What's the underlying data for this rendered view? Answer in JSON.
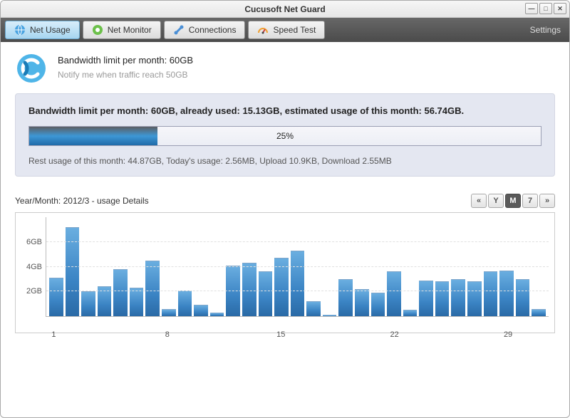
{
  "window": {
    "title": "Cucusoft Net Guard"
  },
  "tabs": [
    {
      "label": "Net Usage"
    },
    {
      "label": "Net Monitor"
    },
    {
      "label": "Connections"
    },
    {
      "label": "Speed Test"
    }
  ],
  "settings_label": "Settings",
  "header": {
    "line1": "Bandwidth limit per month: 60GB",
    "line2": "Notify me when traffic reach 50GB"
  },
  "summary": {
    "title": "Bandwidth limit per month: 60GB, already used: 15.13GB, estimated usage of this month: 56.74GB.",
    "progress_percent": 25,
    "progress_label": "25%",
    "rest_line": "Rest usage of this month: 44.87GB,    Today's usage: 2.56MB, Upload 10.9KB, Download 2.55MB"
  },
  "details": {
    "label": "Year/Month: 2012/3 - usage Details",
    "range": {
      "first": "«",
      "y": "Y",
      "m": "M",
      "seven": "7",
      "last": "»"
    }
  },
  "chart_data": {
    "type": "bar",
    "title": "",
    "xlabel": "",
    "ylabel": "",
    "ylim": [
      0,
      8
    ],
    "yticks": [
      2,
      4,
      6
    ],
    "ytick_labels": [
      "2GB",
      "4GB",
      "6GB"
    ],
    "xticks": [
      1,
      8,
      15,
      22,
      29
    ],
    "categories": [
      1,
      2,
      3,
      4,
      5,
      6,
      7,
      8,
      9,
      10,
      11,
      12,
      13,
      14,
      15,
      16,
      17,
      18,
      19,
      20,
      21,
      22,
      23,
      24,
      25,
      26,
      27,
      28,
      29,
      30,
      31
    ],
    "values": [
      3.1,
      7.2,
      2.0,
      2.4,
      3.8,
      2.3,
      4.5,
      0.6,
      2.1,
      0.9,
      0.3,
      4.1,
      4.3,
      3.6,
      4.7,
      5.3,
      1.2,
      0.1,
      3.0,
      2.2,
      1.9,
      3.6,
      0.5,
      2.9,
      2.8,
      3.0,
      2.8,
      3.6,
      3.7,
      3.0,
      0.6
    ]
  }
}
